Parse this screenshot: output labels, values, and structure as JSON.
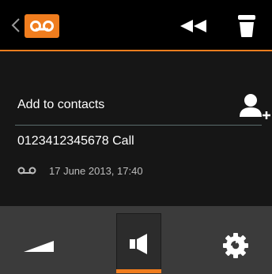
{
  "header": {
    "back_icon": "chevron-left-icon",
    "voicemail_icon": "voicemail-icon",
    "rewind_icon": "rewind-icon",
    "delete_icon": "trash-icon"
  },
  "message": {
    "add_to_contacts": "Add to contacts",
    "add_contact_icon": "add-person-icon",
    "call_line": "0123412345678 Call",
    "timestamp": "17 June 2013, 17:40"
  },
  "controls": {
    "volume_icon": "volume-icon",
    "speaker_icon": "speaker-icon",
    "speaker_active": true,
    "settings_icon": "settings-gear-icon"
  },
  "colors": {
    "accent": "#f07d1e",
    "background": "#161616",
    "bottom_bar": "#3b3b3b"
  }
}
